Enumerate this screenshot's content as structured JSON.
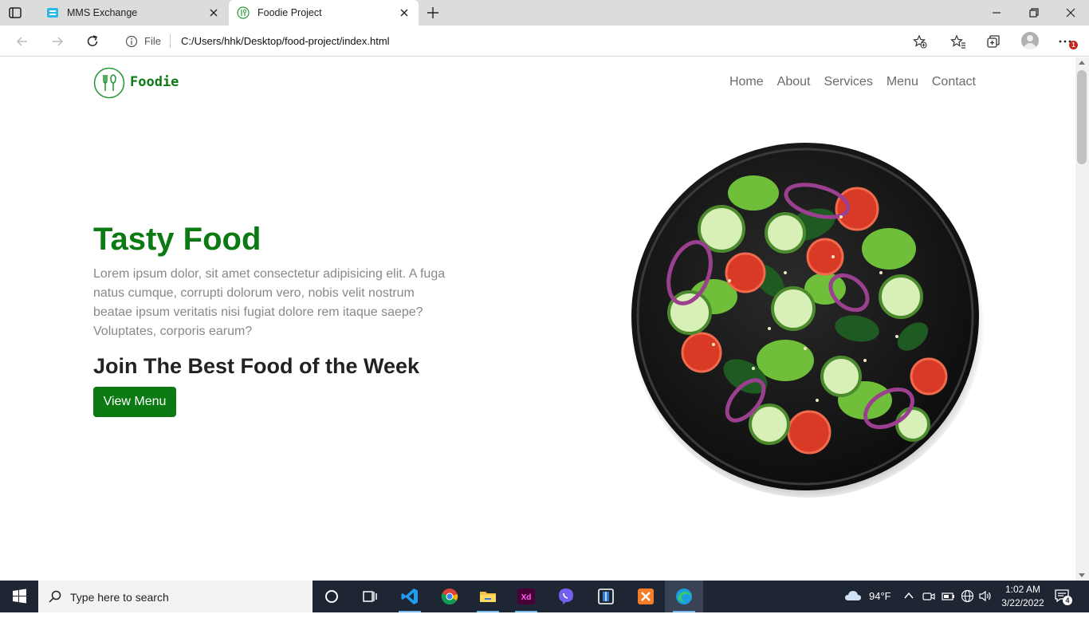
{
  "browser": {
    "tabs": [
      {
        "title": "MMS Exchange",
        "active": false
      },
      {
        "title": "Foodie Project",
        "active": true
      }
    ],
    "address": {
      "scheme_label": "File",
      "url": "C:/Users/hhk/Desktop/food-project/index.html"
    },
    "notification_badge": "1"
  },
  "page": {
    "brand": "Foodie",
    "nav": [
      "Home",
      "About",
      "Services",
      "Menu",
      "Contact"
    ],
    "hero": {
      "title": "Tasty Food",
      "text": "Lorem ipsum dolor, sit amet consectetur adipisicing elit. A fuga natus cumque, corrupti dolorum vero, nobis velit nostrum beatae ipsum veritatis nisi fugiat dolore rem itaque saepe? Voluptates, corporis earum?",
      "subtitle": "Join The Best Food of the Week",
      "button": "View Menu"
    },
    "colors": {
      "accent": "#0b7a12",
      "muted_text": "#888888"
    }
  },
  "taskbar": {
    "search_placeholder": "Type here to search",
    "apps": [
      "task-view",
      "vscode",
      "chrome",
      "file-explorer",
      "adobe-xd",
      "viber",
      "sourcetree",
      "xampp",
      "edge"
    ],
    "weather": "94°F",
    "time": "1:02 AM",
    "date": "3/22/2022",
    "notification_count": "4"
  }
}
